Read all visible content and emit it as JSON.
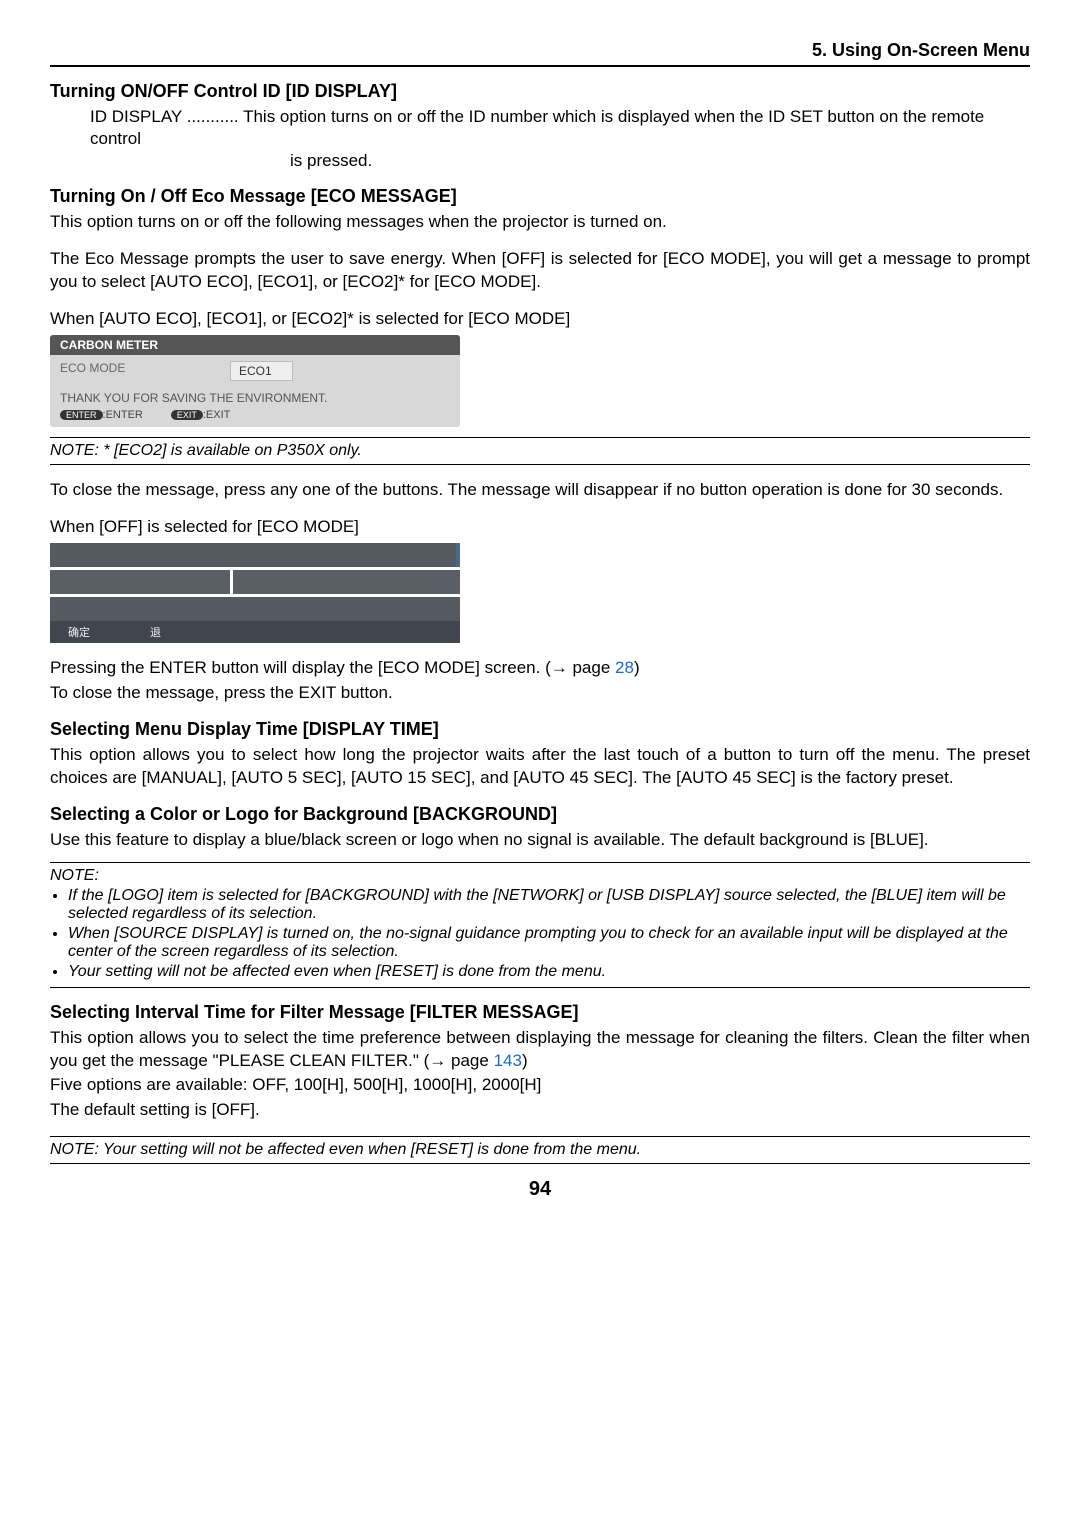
{
  "header": {
    "chapter": "5. Using On-Screen Menu"
  },
  "section1": {
    "title": "Turning ON/OFF Control ID [ID DISPLAY]",
    "def_label": "ID DISPLAY ...........",
    "def_text": "This option turns on or off the ID number which is displayed when the ID SET button on the remote control is pressed.",
    "def_indent": "is pressed."
  },
  "section2": {
    "title": "Turning On / Off Eco Message [ECO MESSAGE]",
    "p1": "This option turns on or off the following messages when the projector is turned on.",
    "p2": "The Eco Message prompts the user to save energy. When [OFF] is selected for [ECO MODE], you will get a message to prompt you to select [AUTO ECO], [ECO1], or [ECO2]* for [ECO MODE].",
    "p3": "When [AUTO ECO], [ECO1], or [ECO2]* is selected for [ECO MODE]"
  },
  "shot1": {
    "title": "CARBON METER",
    "label": "ECO MODE",
    "value": "ECO1",
    "msg": "THANK YOU FOR SAVING THE ENVIRONMENT.",
    "btn1_pill": "ENTER",
    "btn1_txt": ":ENTER",
    "btn2_pill": "EXIT",
    "btn2_txt": ":EXIT"
  },
  "note1": "NOTE: * [ECO2] is available on P350X only.",
  "section2b": {
    "p4": "To close the message, press any one of the buttons. The message will disappear if no button operation is done for 30 seconds.",
    "p5": "When [OFF] is selected for [ECO MODE]"
  },
  "shot2": {
    "f1": "确定",
    "f2": "退"
  },
  "section2c": {
    "p6a": "Pressing the ENTER button will display the [ECO MODE] screen. (→ page ",
    "p6_link": "28",
    "p6b": ")",
    "p7": "To close the message, press the EXIT button."
  },
  "section3": {
    "title": "Selecting Menu Display Time [DISPLAY TIME]",
    "p1": "This option allows you to select how long the projector waits after the last touch of a button to turn off the menu. The preset choices are [MANUAL], [AUTO 5 SEC], [AUTO 15 SEC], and [AUTO 45 SEC]. The [AUTO 45 SEC] is the factory preset."
  },
  "section4": {
    "title": "Selecting a Color or Logo for Background [BACKGROUND]",
    "p1": "Use this feature to display a blue/black screen or logo when no signal is available. The default background is [BLUE]."
  },
  "note2": {
    "label": "NOTE:",
    "b1": "If the [LOGO] item is selected for [BACKGROUND] with the [NETWORK] or [USB DISPLAY] source selected, the [BLUE] item will be selected regardless of its selection.",
    "b2": "When [SOURCE DISPLAY] is turned on, the no-signal guidance prompting you to check for an available input will be displayed at the center of the screen regardless of its selection.",
    "b3": "Your setting will not be affected even when [RESET] is done from the menu."
  },
  "section5": {
    "title": "Selecting Interval Time for Filter Message [FILTER MESSAGE]",
    "p1a": "This option allows you to select the time preference between displaying the message for cleaning the filters. Clean the filter when you get the message \"PLEASE CLEAN FILTER.\" (→ page ",
    "p1_link": "143",
    "p1b": ")",
    "p2": "Five options are available: OFF, 100[H], 500[H], 1000[H], 2000[H]",
    "p3": "The default setting is [OFF]."
  },
  "note3": "NOTE: Your setting will not be affected even when [RESET] is done from the menu.",
  "page_number": "94"
}
